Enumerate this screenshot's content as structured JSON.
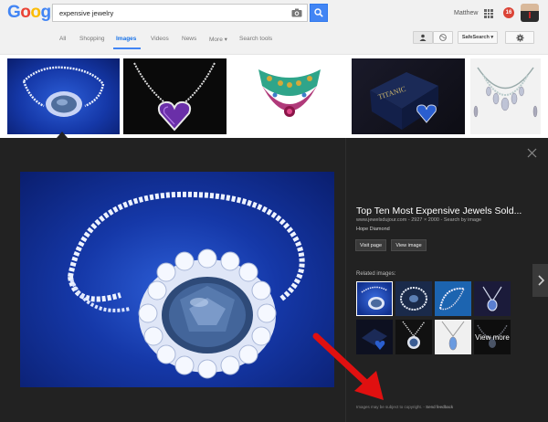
{
  "header": {
    "logo": "Google",
    "search_value": "expensive jewelry",
    "user_name": "Matthew",
    "notification_count": "16"
  },
  "nav": {
    "tabs": [
      {
        "label": "All",
        "active": false
      },
      {
        "label": "Shopping",
        "active": false
      },
      {
        "label": "Images",
        "active": true
      },
      {
        "label": "Videos",
        "active": false
      },
      {
        "label": "News",
        "active": false
      },
      {
        "label": "More ▾",
        "active": false
      },
      {
        "label": "Search tools",
        "active": false
      }
    ],
    "safesearch_label": "SafeSearch ▾"
  },
  "thumbnails": [
    {
      "name": "hope-diamond-necklace"
    },
    {
      "name": "purple-heart-pendant"
    },
    {
      "name": "ruby-emerald-collar"
    },
    {
      "name": "heart-of-ocean-box"
    },
    {
      "name": "diamond-bib-necklace"
    }
  ],
  "preview": {
    "title": "Top Ten Most Expensive Jewels Sold...",
    "meta": "www.jewelsdujour.com - 2927 × 2000 - Search by image",
    "subtitle": "Hope Diamond",
    "visit_page_label": "Visit page",
    "view_image_label": "View image",
    "related_label": "Related images:",
    "view_more_label": "View more",
    "footer_note": "Images may be subject to copyright.",
    "footer_link": "Send feedback"
  },
  "colors": {
    "accent_blue": "#4285f4",
    "panel_bg": "#222222",
    "badge_red": "#db4437",
    "annotation_red": "#e01010"
  }
}
